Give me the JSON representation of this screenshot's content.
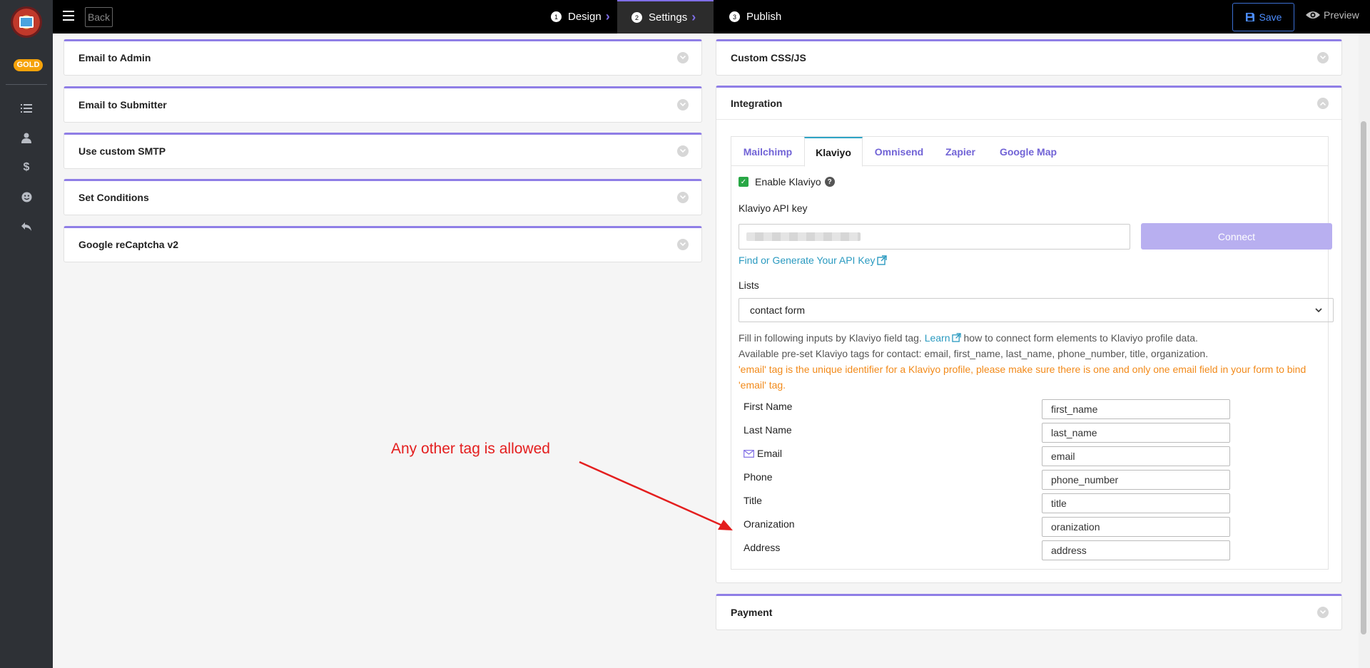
{
  "sidebar": {
    "badge": "GOLD",
    "icons": [
      "list-icon",
      "user-icon",
      "dollar-icon",
      "smiley-icon",
      "undo-icon"
    ]
  },
  "topbar": {
    "back_label": "Back",
    "steps": [
      {
        "num": "1",
        "label": "Design"
      },
      {
        "num": "2",
        "label": "Settings"
      },
      {
        "num": "3",
        "label": "Publish"
      }
    ],
    "save_label": "Save",
    "preview_label": "Preview"
  },
  "left_panels": [
    "Email to Admin",
    "Email to Submitter",
    "Use custom SMTP",
    "Set Conditions",
    "Google reCaptcha v2"
  ],
  "right_panels": {
    "custom_css": "Custom CSS/JS",
    "integration": "Integration",
    "payment": "Payment"
  },
  "integration": {
    "tabs": [
      "Mailchimp",
      "Klaviyo",
      "Omnisend",
      "Zapier",
      "Google Map"
    ],
    "active_tab": "Klaviyo",
    "enable_label": "Enable Klaviyo",
    "api_key_label": "Klaviyo API key",
    "connect_label": "Connect",
    "find_link": "Find or Generate Your API Key",
    "lists_label": "Lists",
    "lists_selected": "contact form",
    "info_line1_pre": "Fill in following inputs by Klaviyo field tag.",
    "info_line1_link": "Learn",
    "info_line1_post": "how to connect form elements to Klaviyo profile data.",
    "info_line2": "Available pre-set Klaviyo tags for contact: email, first_name, last_name, phone_number, title, organization.",
    "info_warn": "'email' tag is the unique identifier for a Klaviyo profile, please make sure there is one and only one email field in your form to bind 'email' tag.",
    "fields": [
      {
        "label": "First Name",
        "value": "first_name"
      },
      {
        "label": "Last Name",
        "value": "last_name"
      },
      {
        "label": "Email",
        "value": "email"
      },
      {
        "label": "Phone",
        "value": "phone_number"
      },
      {
        "label": "Title",
        "value": "title"
      },
      {
        "label": "Oranization",
        "value": "oranization"
      },
      {
        "label": "Address",
        "value": "address"
      }
    ]
  },
  "annotation": "Any other tag is allowed",
  "colors": {
    "accent": "#8f7ee6",
    "gold": "#f5a20a",
    "annotation": "#e41e1e",
    "warning": "#f28a1a",
    "link": "#2a9ac0"
  }
}
